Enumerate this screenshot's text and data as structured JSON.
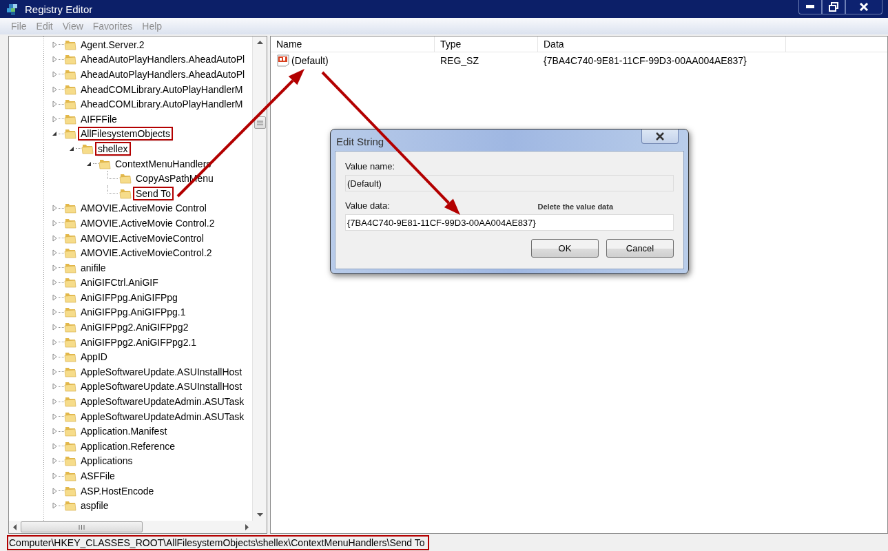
{
  "window": {
    "title": "Registry Editor"
  },
  "menu": [
    "File",
    "Edit",
    "View",
    "Favorites",
    "Help"
  ],
  "tree": [
    {
      "kind": "node",
      "label": "Agent.Server.2",
      "expanded": false,
      "highlighted": false
    },
    {
      "kind": "node",
      "label": "AheadAutoPlayHandlers.AheadAutoPl",
      "expanded": false,
      "highlighted": false
    },
    {
      "kind": "node",
      "label": "AheadAutoPlayHandlers.AheadAutoPl",
      "expanded": false,
      "highlighted": false
    },
    {
      "kind": "node",
      "label": "AheadCOMLibrary.AutoPlayHandlerM",
      "expanded": false,
      "highlighted": false
    },
    {
      "kind": "node",
      "label": "AheadCOMLibrary.AutoPlayHandlerM",
      "expanded": false,
      "highlighted": false
    },
    {
      "kind": "node",
      "label": "AIFFFile",
      "expanded": false,
      "highlighted": false
    },
    {
      "kind": "node",
      "label": "AllFilesystemObjects",
      "expanded": true,
      "highlighted": true,
      "children": [
        {
          "kind": "node",
          "label": "shellex",
          "expanded": true,
          "highlighted": true,
          "children": [
            {
              "kind": "node",
              "label": "ContextMenuHandlers",
              "expanded": true,
              "highlighted": false,
              "children": [
                {
                  "kind": "leaf",
                  "label": "CopyAsPathMenu",
                  "highlighted": false
                },
                {
                  "kind": "leaf",
                  "label": "Send To",
                  "highlighted": true
                }
              ]
            }
          ]
        }
      ]
    },
    {
      "kind": "node",
      "label": "AMOVIE.ActiveMovie Control",
      "expanded": false,
      "highlighted": false
    },
    {
      "kind": "node",
      "label": "AMOVIE.ActiveMovie Control.2",
      "expanded": false,
      "highlighted": false
    },
    {
      "kind": "node",
      "label": "AMOVIE.ActiveMovieControl",
      "expanded": false,
      "highlighted": false
    },
    {
      "kind": "node",
      "label": "AMOVIE.ActiveMovieControl.2",
      "expanded": false,
      "highlighted": false
    },
    {
      "kind": "node",
      "label": "anifile",
      "expanded": false,
      "highlighted": false
    },
    {
      "kind": "node",
      "label": "AniGIFCtrl.AniGIF",
      "expanded": false,
      "highlighted": false
    },
    {
      "kind": "node",
      "label": "AniGIFPpg.AniGIFPpg",
      "expanded": false,
      "highlighted": false
    },
    {
      "kind": "node",
      "label": "AniGIFPpg.AniGIFPpg.1",
      "expanded": false,
      "highlighted": false
    },
    {
      "kind": "node",
      "label": "AniGIFPpg2.AniGIFPpg2",
      "expanded": false,
      "highlighted": false
    },
    {
      "kind": "node",
      "label": "AniGIFPpg2.AniGIFPpg2.1",
      "expanded": false,
      "highlighted": false
    },
    {
      "kind": "node",
      "label": "AppID",
      "expanded": false,
      "highlighted": false
    },
    {
      "kind": "node",
      "label": "AppleSoftwareUpdate.ASUInstallHost",
      "expanded": false,
      "highlighted": false
    },
    {
      "kind": "node",
      "label": "AppleSoftwareUpdate.ASUInstallHost",
      "expanded": false,
      "highlighted": false
    },
    {
      "kind": "node",
      "label": "AppleSoftwareUpdateAdmin.ASUTask",
      "expanded": false,
      "highlighted": false
    },
    {
      "kind": "node",
      "label": "AppleSoftwareUpdateAdmin.ASUTask",
      "expanded": false,
      "highlighted": false
    },
    {
      "kind": "node",
      "label": "Application.Manifest",
      "expanded": false,
      "highlighted": false
    },
    {
      "kind": "node",
      "label": "Application.Reference",
      "expanded": false,
      "highlighted": false
    },
    {
      "kind": "node",
      "label": "Applications",
      "expanded": false,
      "highlighted": false
    },
    {
      "kind": "node",
      "label": "ASFFile",
      "expanded": false,
      "highlighted": false
    },
    {
      "kind": "node",
      "label": "ASP.HostEncode",
      "expanded": false,
      "highlighted": false
    },
    {
      "kind": "node",
      "label": "aspfile",
      "expanded": false,
      "highlighted": false
    }
  ],
  "values": {
    "columns": [
      "Name",
      "Type",
      "Data"
    ],
    "rows": [
      {
        "name": "(Default)",
        "type": "REG_SZ",
        "data": "{7BA4C740-9E81-11CF-99D3-00AA004AE837}"
      }
    ]
  },
  "dialog": {
    "title": "Edit String",
    "value_name_label": "Value name:",
    "value_name": "(Default)",
    "value_data_label": "Value data:",
    "value_data": "{7BA4C740-9E81-11CF-99D3-00AA004AE837}",
    "note": "Delete the value data",
    "buttons": [
      "OK",
      "Cancel"
    ]
  },
  "status_bar": {
    "path": "Computer\\HKEY_CLASSES_ROOT\\AllFilesystemObjects\\shellex\\ContextMenuHandlers\\Send To",
    "highlighted": true
  }
}
